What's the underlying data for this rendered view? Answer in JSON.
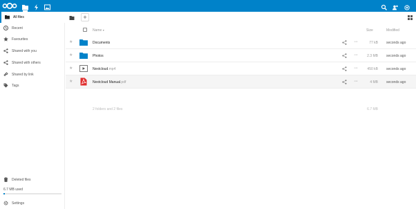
{
  "topbar": {
    "background": "#0082c9",
    "apps": [
      {
        "name": "files-app-icon",
        "active": true
      },
      {
        "name": "activity-app-icon",
        "active": false
      },
      {
        "name": "gallery-app-icon",
        "active": false
      }
    ],
    "right_icons": [
      "search-icon",
      "contacts-icon",
      "settings-gear-icon"
    ]
  },
  "sidebar": {
    "items": [
      {
        "label": "All files",
        "icon": "folder-icon",
        "active": true
      },
      {
        "label": "Recent",
        "icon": "clock-icon"
      },
      {
        "label": "Favourites",
        "icon": "star-icon"
      },
      {
        "label": "Shared with you",
        "icon": "share-icon"
      },
      {
        "label": "Shared with others",
        "icon": "share-icon"
      },
      {
        "label": "Shared by link",
        "icon": "link-icon"
      },
      {
        "label": "Tags",
        "icon": "tag-icon"
      }
    ],
    "deleted_files": "Deleted files",
    "quota": "6.7 MB used",
    "quota_fraction": 0.02,
    "settings": "Settings"
  },
  "main": {
    "add_button": "+",
    "columns": {
      "name": "Name",
      "size": "Size",
      "modified": "Modified"
    },
    "files": [
      {
        "name": "Documents",
        "ext": "",
        "type": "folder",
        "size": "77 kB",
        "modified": "seconds ago"
      },
      {
        "name": "Photos",
        "ext": "",
        "type": "folder",
        "size": "2.3 MB",
        "modified": "seconds ago"
      },
      {
        "name": "Nextcloud",
        "ext": ".mp4",
        "type": "video",
        "size": "450 kB",
        "modified": "seconds ago"
      },
      {
        "name": "Nextcloud Manual",
        "ext": ".pdf",
        "type": "pdf",
        "size": "4 MB",
        "modified": "seconds ago"
      }
    ],
    "summary_counts": "2 folders and 2 files",
    "summary_size": "6.7 MB"
  }
}
